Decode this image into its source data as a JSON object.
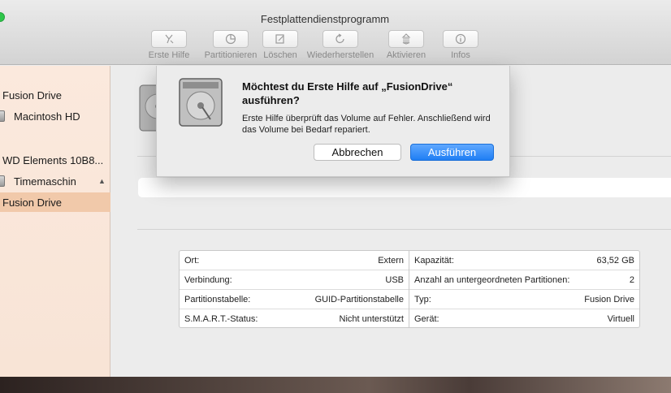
{
  "window": {
    "title": "Festplattendienstprogramm"
  },
  "toolbar": [
    {
      "label": "Erste Hilfe",
      "icon": "first-aid-icon"
    },
    {
      "label": "Partitionieren",
      "icon": "partition-icon"
    },
    {
      "label": "Löschen",
      "icon": "erase-icon"
    },
    {
      "label": "Wiederherstellen",
      "icon": "restore-icon"
    },
    {
      "label": "Aktivieren",
      "icon": "mount-icon"
    },
    {
      "label": "Infos",
      "icon": "info-icon"
    }
  ],
  "sidebar": {
    "items": [
      {
        "label": "Fusion Drive",
        "level": 0,
        "selected": false
      },
      {
        "label": "Macintosh HD",
        "level": 1,
        "selected": false
      },
      {
        "label": "WD Elements 10B8...",
        "level": 0,
        "selected": false
      },
      {
        "label": "Timemaschin",
        "level": 1,
        "selected": false,
        "eject_icon": "eject-icon"
      },
      {
        "label": "Fusion Drive",
        "level": 0,
        "selected": true
      }
    ]
  },
  "dialog": {
    "title": "Möchtest du Erste Hilfe auf „FusionDrive“ ausführen?",
    "body": "Erste Hilfe überprüft das Volume auf Fehler. Anschließend wird das Volume bei Bedarf repariert.",
    "cancel_label": "Abbrechen",
    "run_label": "Ausführen"
  },
  "info": {
    "left": [
      {
        "key": "Ort:",
        "value": "Extern"
      },
      {
        "key": "Verbindung:",
        "value": "USB"
      },
      {
        "key": "Partitionstabelle:",
        "value": "GUID-Partitionstabelle"
      },
      {
        "key": "S.M.A.R.T.-Status:",
        "value": "Nicht unterstützt"
      }
    ],
    "right": [
      {
        "key": "Kapazität:",
        "value": "63,52 GB"
      },
      {
        "key": "Anzahl an untergeordneten Partitionen:",
        "value": "2"
      },
      {
        "key": "Typ:",
        "value": "Fusion Drive"
      },
      {
        "key": "Gerät:",
        "value": "Virtuell"
      }
    ]
  },
  "colors": {
    "accent": "#1f7ef4",
    "sidebar_selected": "#f1c9aa",
    "traffic_green": "#2ec64a"
  }
}
